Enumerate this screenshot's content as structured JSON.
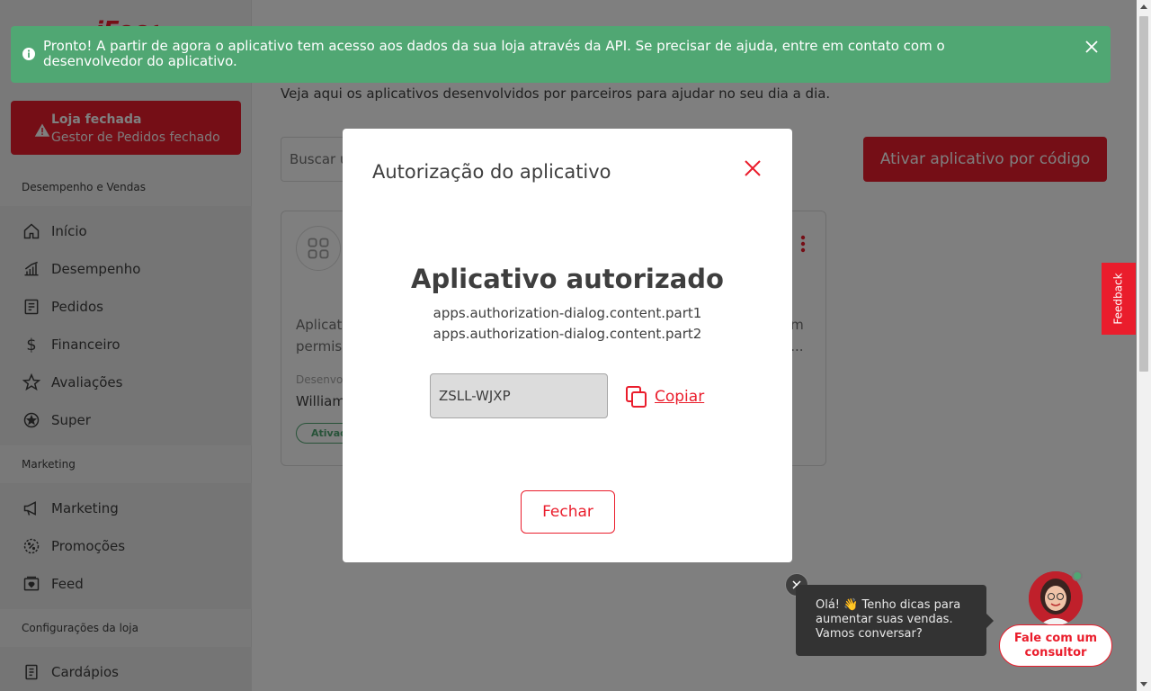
{
  "sidebar": {
    "logo": "iFood",
    "store_alert": {
      "title": "Loja fechada",
      "subtitle": "Gestor de Pedidos fechado",
      "icon": "warning-icon"
    },
    "sections": [
      {
        "title": "Desempenho e Vendas"
      },
      {
        "title": "Marketing"
      },
      {
        "title": "Configurações da loja"
      }
    ],
    "items_sales": [
      {
        "label": "Início",
        "icon": "home-icon"
      },
      {
        "label": "Desempenho",
        "icon": "chart-icon"
      },
      {
        "label": "Pedidos",
        "icon": "orders-icon"
      },
      {
        "label": "Financeiro",
        "icon": "dollar-icon"
      },
      {
        "label": "Avaliações",
        "icon": "star-icon"
      },
      {
        "label": "Super",
        "icon": "super-star-icon"
      }
    ],
    "items_marketing": [
      {
        "label": "Marketing",
        "icon": "megaphone-icon"
      },
      {
        "label": "Promoções",
        "icon": "promo-icon"
      },
      {
        "label": "Feed",
        "icon": "feed-icon"
      }
    ],
    "items_config": [
      {
        "label": "Cardápios",
        "icon": "menu-book-icon"
      }
    ]
  },
  "main": {
    "subtitle": "Veja aqui os aplicativos desenvolvidos por parceiros para ajudar no seu dia a dia.",
    "search_visible_text": "Buscar u",
    "activate_button": "Ativar aplicativo por código",
    "card": {
      "desc_left": "Aplicati\npermiss",
      "desc_right": "om\ná...",
      "dev_label": "Desenvolv",
      "dev_name": "William",
      "status": "Ativad"
    }
  },
  "toast": {
    "message": "Pronto! A partir de agora o aplicativo tem acesso aos dados da sua loja através da API. Se precisar de ajuda, entre em contato com o desenvolvedor do aplicativo."
  },
  "modal": {
    "title": "Autorização do aplicativo",
    "heading": "Aplicativo autorizado",
    "line1": "apps.authorization-dialog.content.part1",
    "line2": "apps.authorization-dialog.content.part2",
    "code": "ZSLL-WJXP",
    "copy_label": "Copiar",
    "close_label": "Fechar"
  },
  "feedback": {
    "label": "Feedback"
  },
  "chat": {
    "bubble": "Olá! 👋 Tenho dicas para aumentar suas vendas. Vamos conversar?",
    "button": "Fale com um consultor"
  },
  "colors": {
    "brand": "#ea1d2c",
    "success": "#50a773",
    "text": "#3e3e3e",
    "sidebar_bg": "#f2f2f2"
  }
}
